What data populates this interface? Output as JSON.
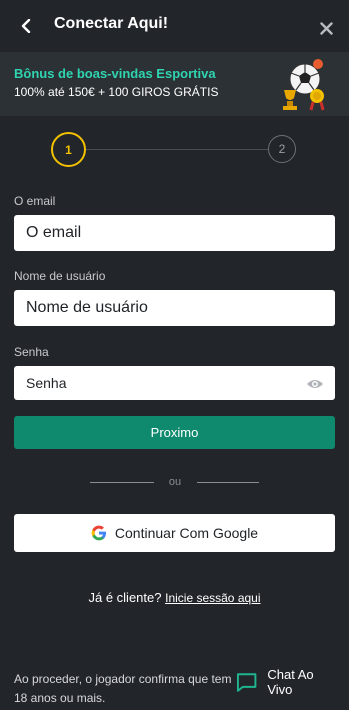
{
  "header": {
    "title": "Conectar Aqui!",
    "back_icon": "chevron-left-icon",
    "close_icon": "close-icon"
  },
  "banner": {
    "title": "Bônus de boas-vindas Esportiva",
    "subtitle": "100% até 150€ + 100 GIROS GRÁTIS",
    "title_color": "#2fd4b0",
    "art_icon": "soccer-ball-trophy-icon"
  },
  "stepper": {
    "step1": "1",
    "step2": "2",
    "active_color": "#f2c100"
  },
  "form": {
    "email": {
      "label": "O email",
      "placeholder": "O email",
      "value": ""
    },
    "username": {
      "label": "Nome de usuário",
      "placeholder": "Nome de usuário",
      "value": ""
    },
    "password": {
      "label": "Senha",
      "placeholder": "Senha",
      "value": ""
    },
    "eye_icon": "eye-icon",
    "next_label": "Proximo",
    "next_color": "#108a6e"
  },
  "divider": {
    "or_text": "ou"
  },
  "google": {
    "label": "Continuar Com Google",
    "icon": "google-icon"
  },
  "client": {
    "question": "Já é cliente?",
    "link": "Inicie sessão aqui"
  },
  "footer": {
    "disclaimer": "Ao proceder, o jogador confirma que tem 18 anos ou mais.",
    "chat_label": "Chat Ao Vivo",
    "chat_icon": "chat-bubble-icon",
    "chat_icon_color": "#1fb58f"
  }
}
